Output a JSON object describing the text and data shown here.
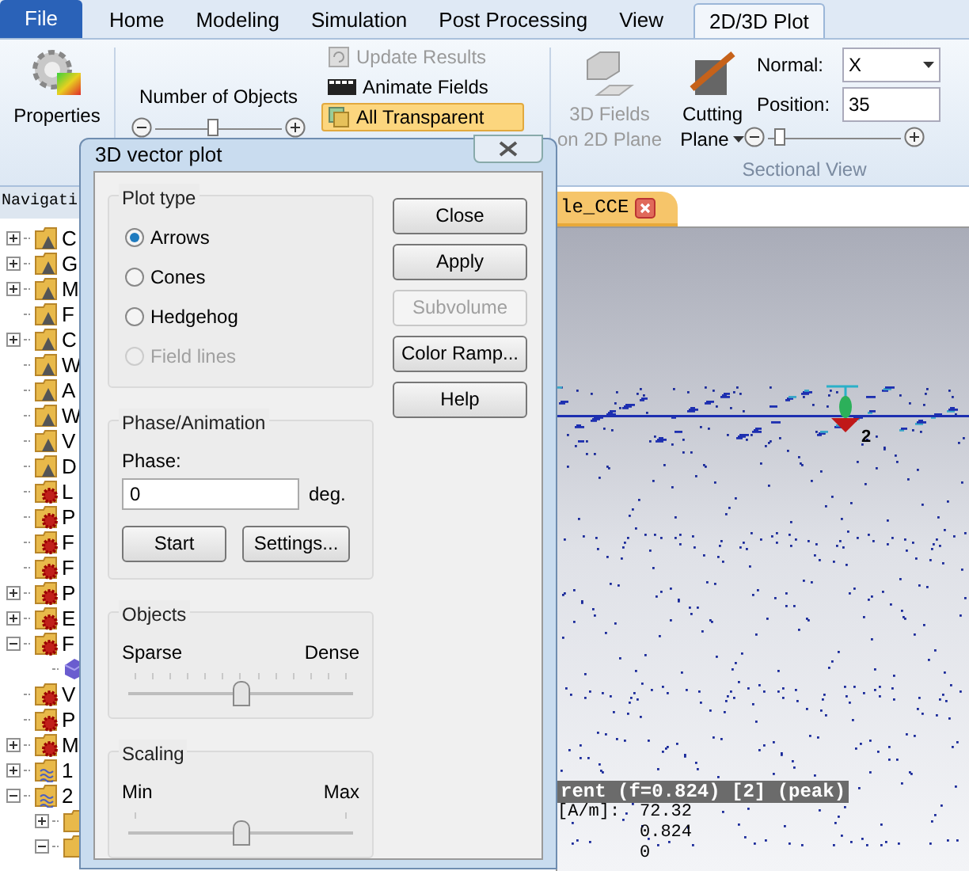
{
  "ribbon_tabs": [
    {
      "label": "File",
      "kind": "file",
      "selected": false
    },
    {
      "label": "Home",
      "kind": "tab",
      "selected": false
    },
    {
      "label": "Modeling",
      "kind": "tab",
      "selected": false
    },
    {
      "label": "Simulation",
      "kind": "tab",
      "selected": false
    },
    {
      "label": "Post Processing",
      "kind": "tab",
      "selected": false
    },
    {
      "label": "View",
      "kind": "tab",
      "selected": false
    },
    {
      "label": "2D/3D Plot",
      "kind": "tab",
      "selected": true
    }
  ],
  "ribbon": {
    "properties": "Properties",
    "number_of_objects": {
      "label": "Number of Objects",
      "level": 0.45
    },
    "commands": [
      {
        "label": "Update Results",
        "disabled": true,
        "highlighted": false,
        "kind": "refresh"
      },
      {
        "label": "Animate Fields",
        "disabled": false,
        "highlighted": false,
        "kind": "film"
      },
      {
        "label": "All Transparent",
        "disabled": false,
        "highlighted": true,
        "kind": "layers"
      }
    ],
    "fields_2d": {
      "line1": "3D Fields",
      "line2": "on 2D Plane",
      "disabled": true
    },
    "cutting_plane": {
      "line1": "Cutting",
      "line2": "Plane"
    },
    "normal": {
      "label": "Normal:",
      "value": "X"
    },
    "position": {
      "label": "Position:",
      "value": "35",
      "level": 0.05
    },
    "group_label": "Sectional View"
  },
  "navigation": {
    "title": "Navigati",
    "items": [
      {
        "label": "C",
        "kind": "warning",
        "expanded": false
      },
      {
        "label": "G",
        "kind": "warning",
        "expanded": false
      },
      {
        "label": "M",
        "kind": "warning",
        "expanded": false
      },
      {
        "label": "F",
        "kind": "warning"
      },
      {
        "label": "C",
        "kind": "warning",
        "expanded": false
      },
      {
        "label": "W",
        "kind": "warning"
      },
      {
        "label": "A",
        "kind": "warning"
      },
      {
        "label": "W",
        "kind": "warning"
      },
      {
        "label": "V",
        "kind": "warning"
      },
      {
        "label": "D",
        "kind": "warning"
      },
      {
        "label": "L",
        "kind": "gear"
      },
      {
        "label": "P",
        "kind": "gear"
      },
      {
        "label": "F",
        "kind": "gear"
      },
      {
        "label": "F",
        "kind": "gear"
      },
      {
        "label": "P",
        "kind": "gear",
        "expanded": false
      },
      {
        "label": "E",
        "kind": "gear",
        "expanded": false
      },
      {
        "label": "F",
        "kind": "gear",
        "expanded": true,
        "children": [
          {
            "kind": "cube"
          }
        ]
      },
      {
        "label": "V",
        "kind": "gear"
      },
      {
        "label": "P",
        "kind": "gear"
      },
      {
        "label": "M",
        "kind": "gear",
        "expanded": false
      },
      {
        "label": "1",
        "kind": "wave",
        "expanded": false
      },
      {
        "label": "2",
        "kind": "wave",
        "expanded": true,
        "children": [
          {
            "kind": "folder",
            "expanded": false
          },
          {
            "kind": "folder",
            "expanded": true
          }
        ]
      }
    ]
  },
  "document_tab": {
    "label": "le_CCE"
  },
  "viewport": {
    "port_label": "2",
    "legend": {
      "title": "rent (f=0.824) [2] (peak)",
      "rows": [
        {
          "label": "[A/m]:",
          "value": "72.32"
        },
        {
          "label": "",
          "value": "0.824"
        },
        {
          "label": "",
          "value": "0"
        }
      ]
    }
  },
  "dialog": {
    "title": "3D vector plot",
    "plot_type": {
      "title": "Plot type",
      "options": [
        {
          "label": "Arrows",
          "selected": true,
          "disabled": false
        },
        {
          "label": "Cones",
          "selected": false,
          "disabled": false
        },
        {
          "label": "Hedgehog",
          "selected": false,
          "disabled": false
        },
        {
          "label": "Field lines",
          "selected": false,
          "disabled": true
        }
      ]
    },
    "buttons": [
      {
        "label": "Close",
        "disabled": false
      },
      {
        "label": "Apply",
        "disabled": false
      },
      {
        "label": "Subvolume",
        "disabled": true
      },
      {
        "label": "Color Ramp...",
        "disabled": false
      },
      {
        "label": "Help",
        "disabled": false
      }
    ],
    "phase": {
      "title": "Phase/Animation",
      "label": "Phase:",
      "value": "0",
      "unit": "deg.",
      "start": "Start",
      "settings": "Settings..."
    },
    "objects": {
      "title": "Objects",
      "min": "Sparse",
      "max": "Dense",
      "level": 0.5
    },
    "scaling": {
      "title": "Scaling",
      "min": "Min",
      "max": "Max",
      "level": 0.5
    }
  }
}
